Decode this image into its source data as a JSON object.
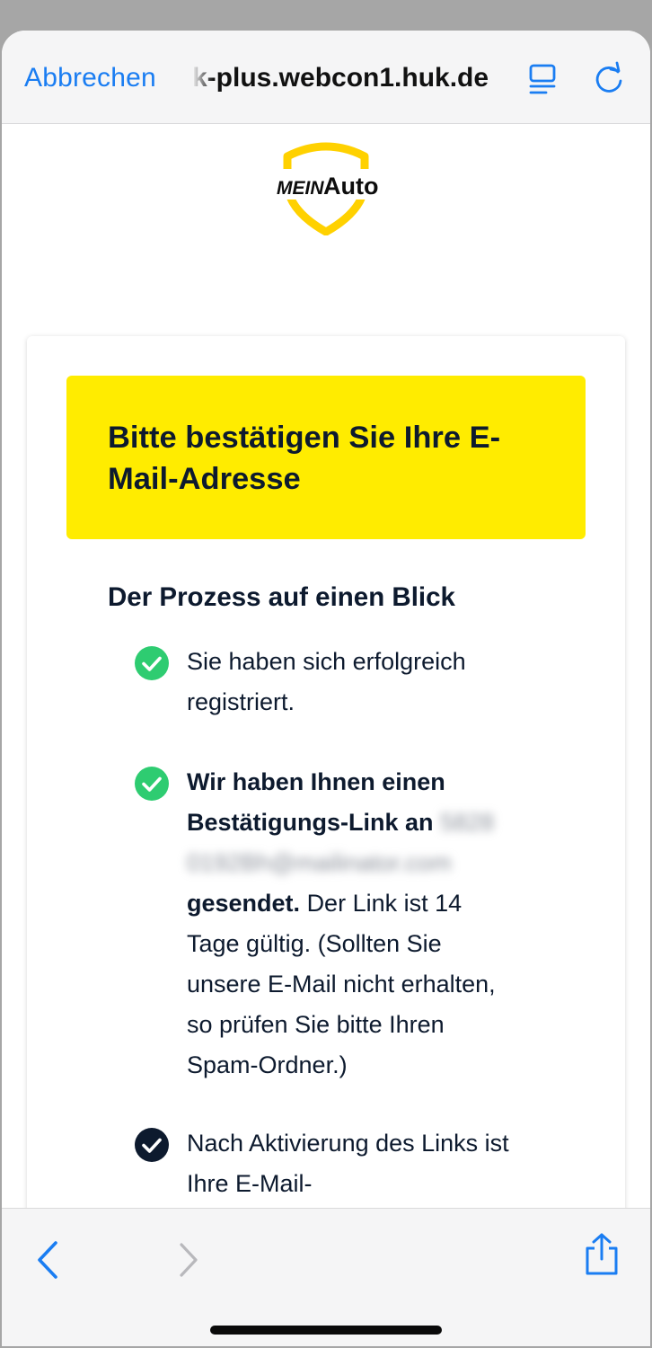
{
  "browser": {
    "cancel_label": "Abbrechen",
    "url": "k-plus.webcon1.huk.de"
  },
  "logo": {
    "word1": "MEIN",
    "word2": "Auto"
  },
  "card": {
    "banner_title": "Bitte bestätigen Sie Ihre E-Mail-Adresse",
    "section_title": "Der Prozess auf einen Blick",
    "steps": [
      {
        "text": "Sie haben sich erfolgreich registriert."
      },
      {
        "bold_prefix": "Wir haben Ihnen einen Bestätigungs-Link an",
        "email": "5828 0192Bh@mailinator.com",
        "bold_suffix": "gesendet.",
        "text": "Der Link ist 14 Tage gültig. (Sollten Sie unsere E-Mail nicht erhalten, so prüfen Sie bitte Ihren Spam-Ordner.)"
      },
      {
        "text": "Nach Aktivierung des Links ist Ihre E-Mail-"
      }
    ]
  },
  "colors": {
    "accent": "#1a7df2",
    "banner": "#ffec00",
    "check_done": "#2ecc71",
    "check_pending": "#0d1a2e",
    "logo_yellow": "#ffd100"
  },
  "icons": {
    "reader": "reader-mode-icon",
    "reload": "reload-icon",
    "back": "chevron-left-icon",
    "forward": "chevron-right-icon",
    "share": "share-icon"
  }
}
